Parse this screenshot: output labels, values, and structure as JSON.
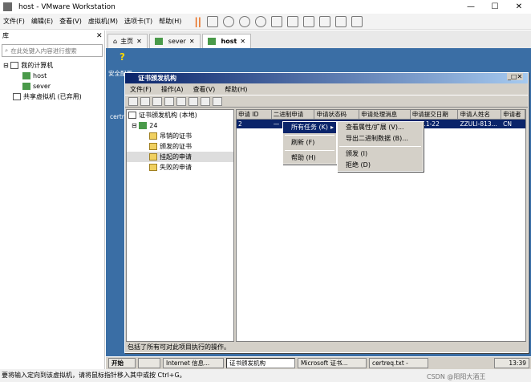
{
  "window": {
    "title": "host - VMware Workstation",
    "close": "✕",
    "min": "—",
    "max": "☐"
  },
  "menu": [
    "文件(F)",
    "编辑(E)",
    "查看(V)",
    "虚拟机(M)",
    "选项卡(T)",
    "帮助(H)"
  ],
  "library": {
    "title": "库",
    "search_placeholder": "在此处键入内容进行搜索",
    "my_computer": "我的计算机",
    "host": "host",
    "sever": "sever",
    "shared": "共享虚拟机 (已弃用)"
  },
  "tabs": [
    "主页",
    "sever",
    "host"
  ],
  "desktop": {
    "label1": "安全配置",
    "label2": "certr"
  },
  "ca": {
    "title": "证书颁发机构",
    "menu": [
      "文件(F)",
      "操作(A)",
      "查看(V)",
      "帮助(H)"
    ],
    "tree": {
      "root": "证书颁发机构 (本地)",
      "node": "24",
      "items": [
        "吊销的证书",
        "颁发的证书",
        "挂起的申请",
        "失败的申请"
      ]
    },
    "columns": [
      "申请 ID",
      "二进制申请",
      "申请状态码",
      "申请处理消息",
      "申请提交日期",
      "申请人姓名",
      "申请者"
    ],
    "row": {
      "id": "2",
      "bin": "—",
      "date": "24-11-22",
      "name": "ZZULI-813...",
      "cn": "CN"
    },
    "status": "包括了所有可对此项目执行的操作。"
  },
  "ctx1": {
    "all": "所有任务 (K)",
    "refresh": "刷新 (F)",
    "help": "帮助 (H)"
  },
  "ctx2": {
    "view": "查看属性/扩展 (V)...",
    "export": "导出二进制数据 (B)...",
    "issue": "颁发 (I)",
    "deny": "拒绝 (D)"
  },
  "taskbar": {
    "start": "开始",
    "items": [
      "Internet 信息...",
      "证书颁发机构",
      "Microsoft 证书...",
      "certreq.txt -"
    ],
    "time": "13:39"
  },
  "bottom": "要将输入定向到该虚拟机，请将鼠标指针移入其中或按 Ctrl+G。",
  "watermark": "CSDN @阳阳大酒王"
}
